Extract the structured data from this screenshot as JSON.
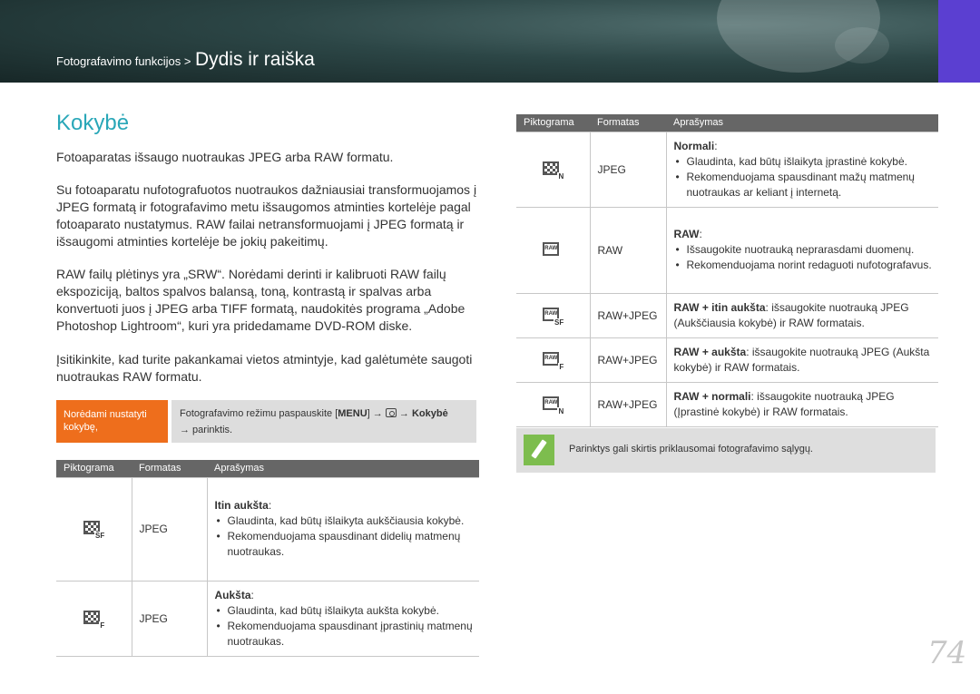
{
  "header": {
    "breadcrumb_section": "Fotografavimo funkcijos >",
    "breadcrumb_current": "Dydis ir raiška"
  },
  "page": {
    "title": "Kokybė",
    "paragraphs": [
      "Fotoaparatas išsaugo nuotraukas JPEG arba RAW formatu.",
      "Su fotoaparatu nufotografuotos nuotraukos dažniausiai transformuojamos į JPEG formatą ir fotografavimo metu išsaugomos atminties kortelėje pagal fotoaparato nustatymus. RAW failai netransformuojami į JPEG formatą ir išsaugomi atminties kortelėje be jokių pakeitimų.",
      "RAW failų plėtinys yra „SRW“. Norėdami derinti ir kalibruoti RAW failų ekspoziciją, baltos spalvos balansą, toną, kontrastą ir spalvas arba konvertuoti juos į JPEG arba TIFF formatą, naudokitės programa „Adobe Photoshop Lightroom“, kuri yra pridedamame DVD-ROM diske.",
      "Įsitikinkite, kad turite pakankamai vietos atmintyje, kad galėtumėte saugoti nuotraukas RAW formatu."
    ],
    "page_number": "74"
  },
  "callout": {
    "label": "Norėdami nustatyti kokybę,",
    "text_1": "Fotografavimo režimu paspauskite [",
    "menu_key": "MENU",
    "text_2": "] →",
    "arrow": "→",
    "target": "Kokybė",
    "text_3": "→ parinktis."
  },
  "table_headers": {
    "icon": "Piktograma",
    "format": "Formatas",
    "desc": "Aprašymas"
  },
  "table_left": {
    "rows": [
      {
        "icon": "quality-superfine-icon",
        "format": "JPEG",
        "head": "Itin aukšta",
        "head_suffix": ":",
        "bullets": [
          "Glaudinta, kad būtų išlaikyta aukščiausia kokybė.",
          "Rekomenduojama spausdinant didelių matmenų nuotraukas."
        ]
      },
      {
        "icon": "quality-fine-icon",
        "format": "JPEG",
        "head": "Aukšta",
        "head_suffix": ":",
        "bullets": [
          "Glaudinta, kad būtų išlaikyta aukšta kokybė.",
          "Rekomenduojama spausdinant įprastinių matmenų nuotraukas."
        ]
      }
    ]
  },
  "table_right": {
    "rows": [
      {
        "icon": "quality-normal-icon",
        "format": "JPEG",
        "head": "Normali",
        "head_suffix": ":",
        "bullets": [
          "Glaudinta, kad būtų išlaikyta įprastinė kokybė.",
          "Rekomenduojama spausdinant mažų matmenų nuotraukas ar keliant į internetą."
        ]
      },
      {
        "icon": "raw-icon",
        "format": "RAW",
        "head": "RAW",
        "head_suffix": ":",
        "bullets": [
          "Išsaugokite nuotrauką neprarasdami duomenų.",
          "Rekomenduojama norint redaguoti nufotografavus."
        ]
      },
      {
        "icon": "raw-superfine-icon",
        "format": "RAW+JPEG",
        "head": "RAW + itin aukšta",
        "head_suffix": ": išsaugokite nuotrauką JPEG (Aukščiausia kokybė) ir RAW formatais."
      },
      {
        "icon": "raw-fine-icon",
        "format": "RAW+JPEG",
        "head": "RAW + aukšta",
        "head_suffix": ": išsaugokite nuotrauką JPEG (Aukšta kokybė) ir RAW formatais."
      },
      {
        "icon": "raw-normal-icon",
        "format": "RAW+JPEG",
        "head": "RAW + normali",
        "head_suffix": ": išsaugokite nuotrauką JPEG (Įprastinė kokybė) ir RAW formatais."
      }
    ]
  },
  "note": {
    "icon": "pencil-note-icon",
    "text": "Parinktys gali skirtis priklausomai fotografavimo sąlygų."
  },
  "colors": {
    "title": "#29a7b8",
    "callout": "#ee6e1c",
    "note_icon": "#7dbd4e",
    "table_header": "#666666"
  }
}
